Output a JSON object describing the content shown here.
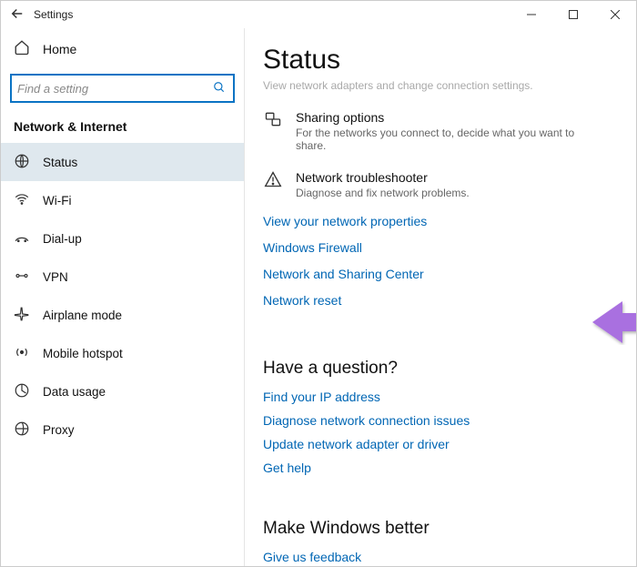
{
  "titlebar": {
    "title": "Settings"
  },
  "sidebar": {
    "home_label": "Home",
    "search_placeholder": "Find a setting",
    "group_label": "Network & Internet",
    "items": [
      {
        "icon": "globe",
        "label": "Status",
        "selected": true
      },
      {
        "icon": "wifi",
        "label": "Wi-Fi",
        "selected": false
      },
      {
        "icon": "dialup",
        "label": "Dial-up",
        "selected": false
      },
      {
        "icon": "vpn",
        "label": "VPN",
        "selected": false
      },
      {
        "icon": "airplane",
        "label": "Airplane mode",
        "selected": false
      },
      {
        "icon": "hotspot",
        "label": "Mobile hotspot",
        "selected": false
      },
      {
        "icon": "datausage",
        "label": "Data usage",
        "selected": false
      },
      {
        "icon": "proxy",
        "label": "Proxy",
        "selected": false
      }
    ]
  },
  "main": {
    "page_title": "Status",
    "faded_line": "View network adapters and change connection settings.",
    "sections": [
      {
        "icon": "sharing",
        "heading": "Sharing options",
        "sub": "For the networks you connect to, decide what you want to share."
      },
      {
        "icon": "troubleshoot",
        "heading": "Network troubleshooter",
        "sub": "Diagnose and fix network problems."
      }
    ],
    "links": [
      "View your network properties",
      "Windows Firewall",
      "Network and Sharing Center",
      "Network reset"
    ],
    "question_title": "Have a question?",
    "question_links": [
      "Find your IP address",
      "Diagnose network connection issues",
      "Update network adapter or driver",
      "Get help"
    ],
    "better_title": "Make Windows better",
    "better_links": [
      "Give us feedback"
    ]
  }
}
